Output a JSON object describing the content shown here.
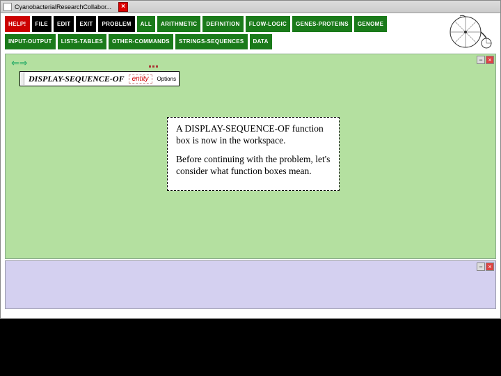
{
  "titlebar": {
    "text": "CyanobacterialResearchCollabor..."
  },
  "toolbar": {
    "buttons": [
      {
        "label": "HELP!",
        "style": "red"
      },
      {
        "label": "FILE",
        "style": ""
      },
      {
        "label": "EDIT",
        "style": ""
      },
      {
        "label": "EXIT",
        "style": ""
      },
      {
        "label": "PROBLEM",
        "style": ""
      },
      {
        "label": "ALL",
        "style": "green"
      },
      {
        "label": "ARITHMETIC",
        "style": "green"
      },
      {
        "label": "DEFINITION",
        "style": "green"
      },
      {
        "label": "FLOW-LOGIC",
        "style": "green"
      },
      {
        "label": "GENES-PROTEINS",
        "style": "green"
      },
      {
        "label": "GENOME",
        "style": "green"
      },
      {
        "label": "INPUT-OUTPUT",
        "style": "green"
      },
      {
        "label": "LISTS-TABLES",
        "style": "green"
      },
      {
        "label": "OTHER-COMMANDS",
        "style": "green"
      },
      {
        "label": "STRINGS-SEQUENCES",
        "style": "green"
      },
      {
        "label": "DATA",
        "style": "green"
      }
    ]
  },
  "workspace": {
    "arrows": "⇐ ⇒",
    "func": {
      "name": "DISPLAY-SEQUENCE-OF",
      "entity": "entity",
      "options": "Options"
    },
    "info": {
      "p1": "A DISPLAY-SEQUENCE-OF function box is now in the workspace.",
      "p2": "Before continuing with the problem, let's consider what function boxes mean."
    }
  }
}
